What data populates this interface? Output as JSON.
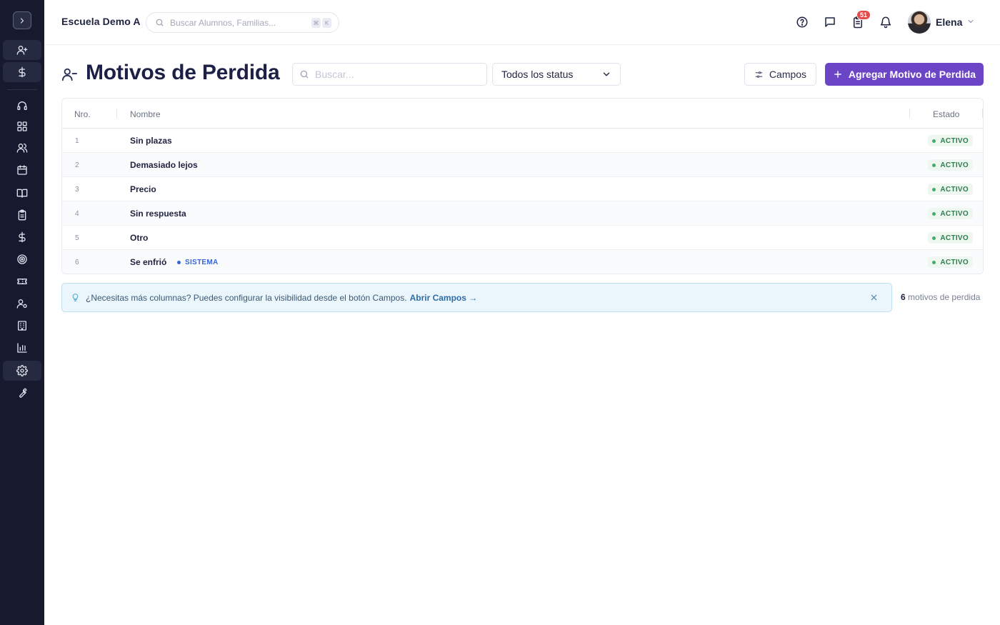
{
  "topbar": {
    "school_name": "Escuela Demo A",
    "search_placeholder": "Buscar Alumnos, Familias...",
    "kbd1": "⌘",
    "kbd2": "K",
    "notifications_badge": "51",
    "user_name": "Elena"
  },
  "header": {
    "title": "Motivos de Perdida",
    "search_placeholder": "Buscar...",
    "status_select": "Todos los status",
    "campos_label": "Campos",
    "add_label": "Agregar Motivo de Perdida"
  },
  "table": {
    "columns": {
      "nro": "Nro.",
      "nombre": "Nombre",
      "estado": "Estado"
    },
    "rows": [
      {
        "nro": "1",
        "nombre": "Sin plazas",
        "estado": "ACTIVO"
      },
      {
        "nro": "2",
        "nombre": "Demasiado lejos",
        "estado": "ACTIVO"
      },
      {
        "nro": "3",
        "nombre": "Precio",
        "estado": "ACTIVO"
      },
      {
        "nro": "4",
        "nombre": "Sin respuesta",
        "estado": "ACTIVO"
      },
      {
        "nro": "5",
        "nombre": "Otro",
        "estado": "ACTIVO"
      },
      {
        "nro": "6",
        "nombre": "Se enfrió",
        "tag": "SISTEMA",
        "estado": "ACTIVO"
      }
    ]
  },
  "banner": {
    "text": "¿Necesitas más columnas? Puedes configurar la visibilidad desde el botón Campos.",
    "link": "Abrir Campos →"
  },
  "count": {
    "number": "6",
    "label": "motivos de perdida"
  },
  "colors": {
    "sidebar": "#171a2e",
    "primary": "#6b45c6",
    "active_status": "#2e7d4f",
    "sistema": "#3a64d8",
    "badge": "#e54b4b"
  },
  "sidebar": {
    "icons": [
      "chevron-right-icon",
      "user-plus-icon",
      "dollar-icon",
      "headset-icon",
      "grid-icon",
      "users-icon",
      "calendar-icon",
      "book-icon",
      "clipboard-icon",
      "dollar-icon",
      "target-icon",
      "ticket-icon",
      "user-settings-icon",
      "building-icon",
      "bar-chart-icon",
      "gear-icon",
      "wrench-icon"
    ]
  }
}
